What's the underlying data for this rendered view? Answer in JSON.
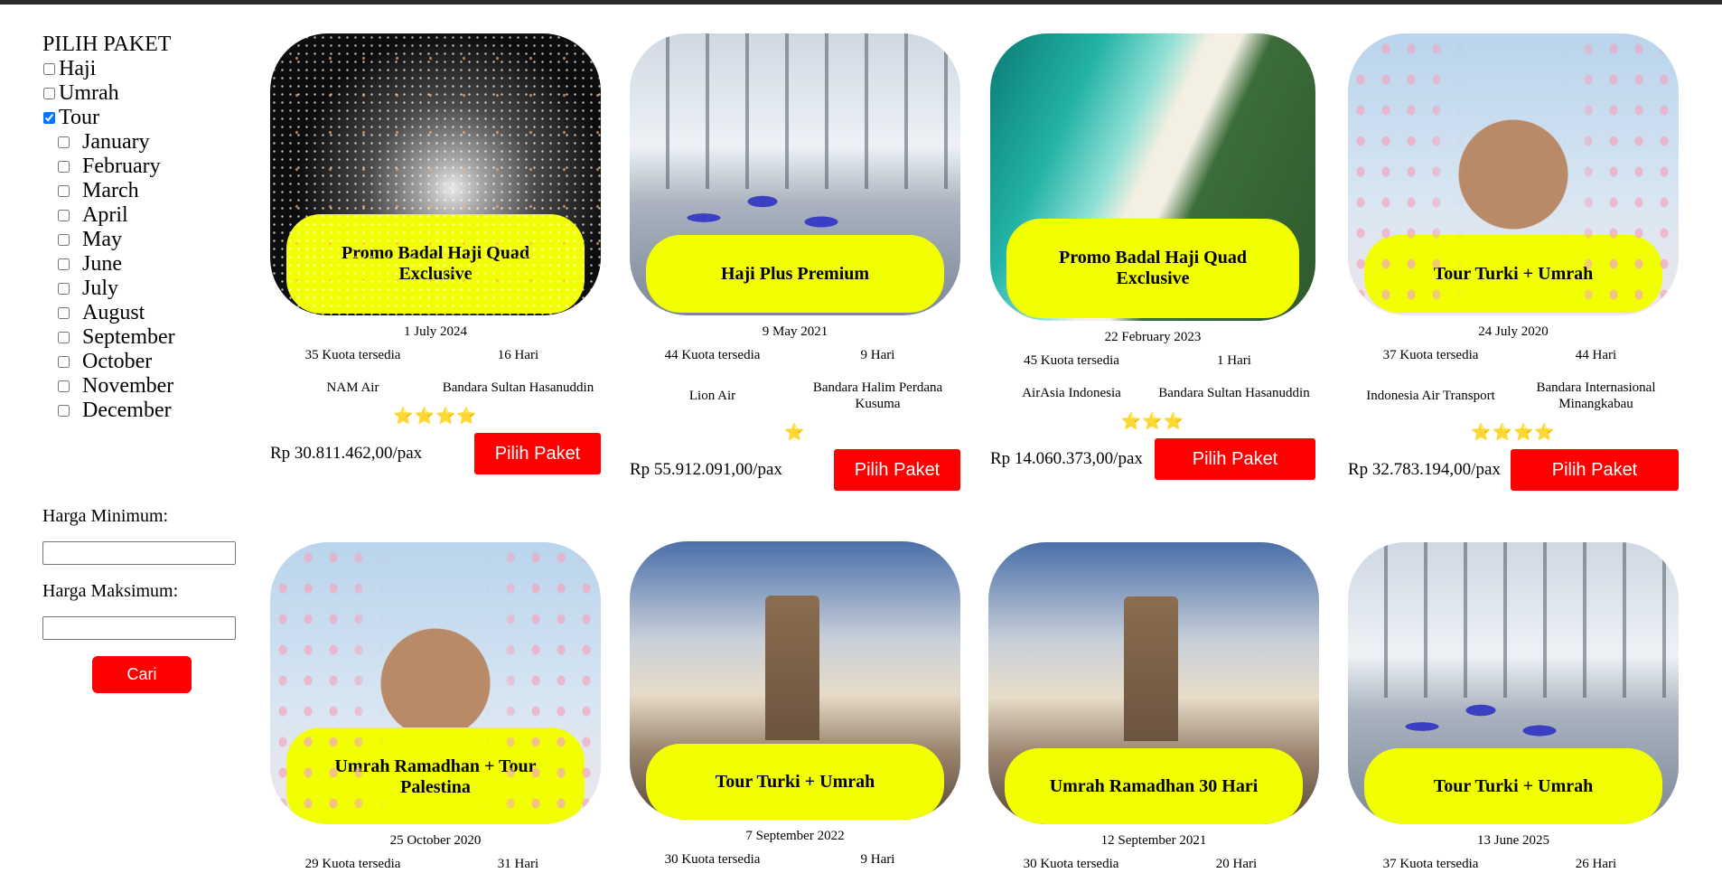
{
  "sidebar": {
    "title": "PILIH PAKET",
    "categories": [
      {
        "label": "Haji",
        "checked": false
      },
      {
        "label": "Umrah",
        "checked": false
      },
      {
        "label": "Tour",
        "checked": true
      }
    ],
    "months": [
      "January",
      "February",
      "March",
      "April",
      "May",
      "June",
      "July",
      "August",
      "September",
      "October",
      "November",
      "December"
    ],
    "min_price_label": "Harga Minimum:",
    "max_price_label": "Harga Maksimum:",
    "min_price_value": "",
    "max_price_value": "",
    "search_label": "Cari"
  },
  "cards": [
    {
      "title": "Promo Badal Haji Quad Exclusive",
      "date": "1 July 2024",
      "quota": "35 Kuota tersedia",
      "duration": "16 Hari",
      "airline": "NAM Air",
      "airport": "Bandara Sultan Hasanuddin",
      "stars": "⭐⭐⭐⭐",
      "rating": 4,
      "price": "Rp 30.811.462,00/pax",
      "button": "Pilih Paket",
      "photo": "stars"
    },
    {
      "title": "Haji Plus Premium",
      "date": "9 May 2021",
      "quota": "44 Kuota tersedia",
      "duration": "9 Hari",
      "airline": "Lion Air",
      "airport": "Bandara Halim Perdana Kusuma",
      "stars": "⭐",
      "rating": 1,
      "price": "Rp 55.912.091,00/pax",
      "button": "Pilih Paket",
      "photo": "airport"
    },
    {
      "title": "Promo Badal Haji Quad Exclusive",
      "date": "22 February 2023",
      "quota": "45 Kuota tersedia",
      "duration": "1 Hari",
      "airline": "AirAsia Indonesia",
      "airport": "Bandara Sultan Hasanuddin",
      "stars": "⭐⭐⭐",
      "rating": 3,
      "price": "Rp 14.060.373,00/pax",
      "button": "Pilih Paket",
      "photo": "beach"
    },
    {
      "title": "Tour Turki + Umrah",
      "date": "24 July 2020",
      "quota": "37 Kuota tersedia",
      "duration": "44 Hari",
      "airline": "Indonesia Air Transport",
      "airport": "Bandara Internasional Minangkabau",
      "stars": "⭐⭐⭐⭐",
      "rating": 4,
      "price": "Rp 32.783.194,00/pax",
      "button": "Pilih Paket",
      "photo": "blossom"
    },
    {
      "title": "Umrah Ramadhan + Tour Palestina",
      "date": "25 October 2020",
      "quota": "29 Kuota tersedia",
      "duration": "31 Hari",
      "photo": "blossom"
    },
    {
      "title": "Tour Turki + Umrah",
      "date": "7 September 2022",
      "quota": "30 Kuota tersedia",
      "duration": "9 Hari",
      "photo": "mecca"
    },
    {
      "title": "Umrah Ramadhan 30 Hari",
      "date": "12 September 2021",
      "quota": "30 Kuota tersedia",
      "duration": "20 Hari",
      "photo": "mecca"
    },
    {
      "title": "Tour Turki + Umrah",
      "date": "13 June 2025",
      "quota": "37 Kuota tersedia",
      "duration": "26 Hari",
      "photo": "airport"
    }
  ]
}
